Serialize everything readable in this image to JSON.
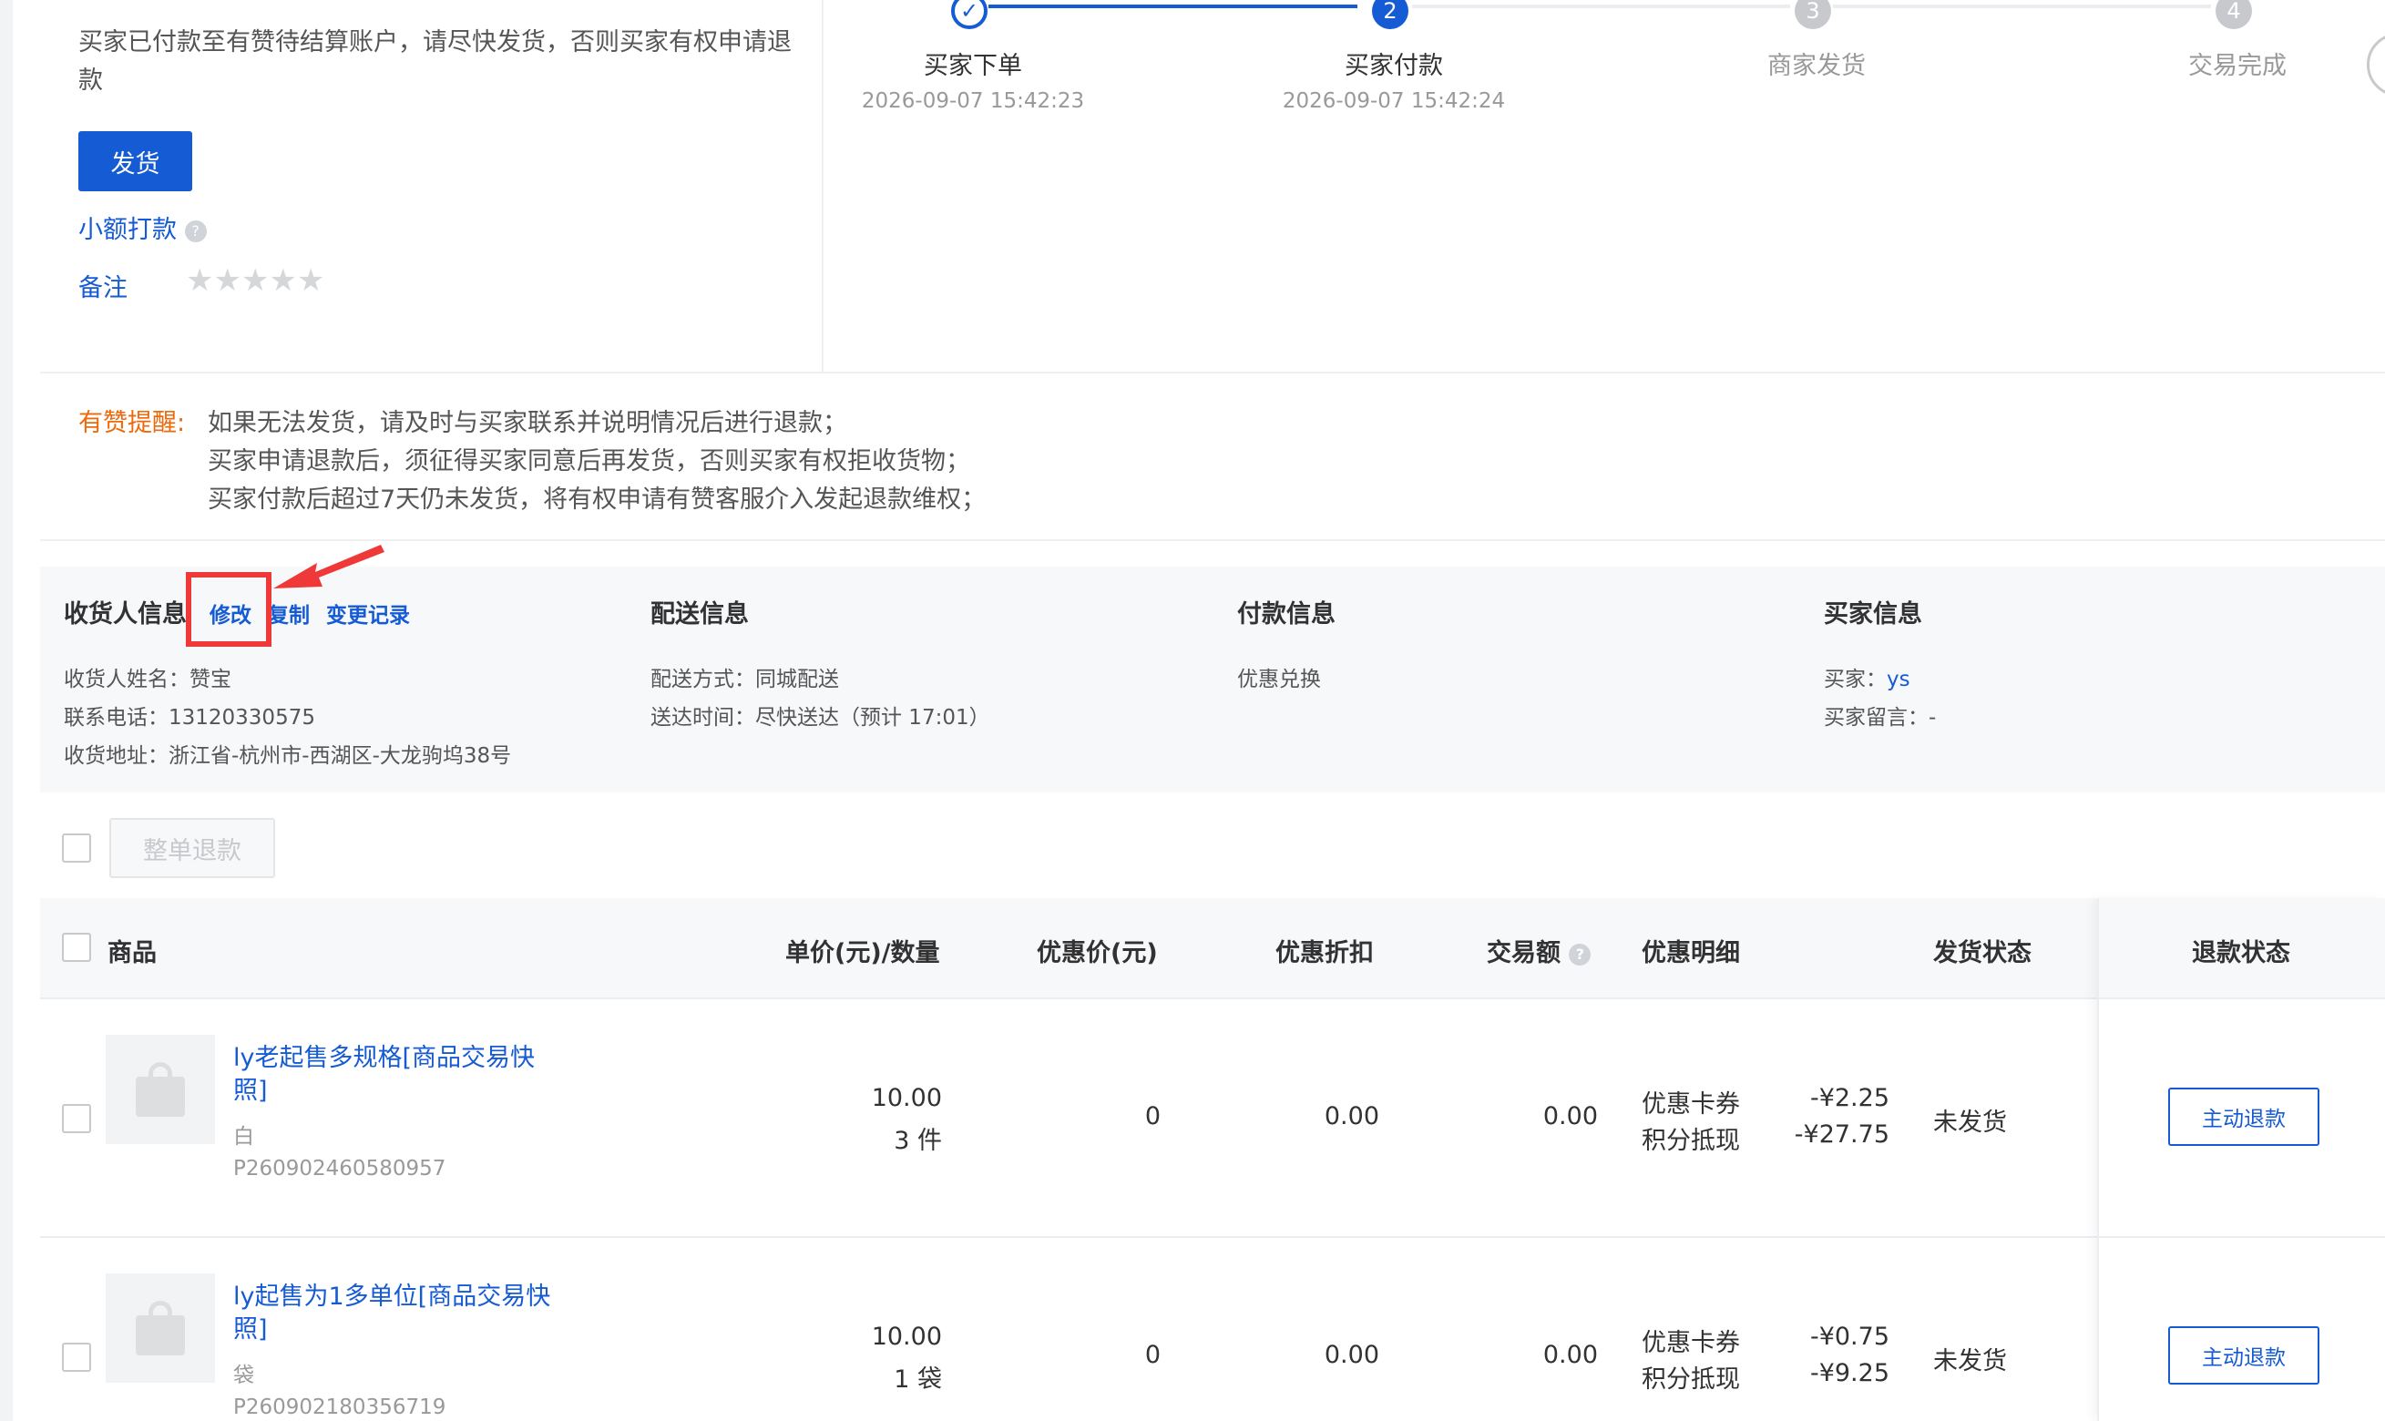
{
  "status": {
    "description": "买家已付款至有赞待结算账户，请尽快发货，否则买家有权申请退款",
    "ship_button": "发货",
    "small_payment_link": "小额打款",
    "remark_label": "备注",
    "remark_stars": 0,
    "remark_stars_max": 5
  },
  "steps": [
    {
      "label": "买家下单",
      "time": "2026-09-07 15:42:23",
      "marker": "✓",
      "state": "done"
    },
    {
      "label": "买家付款",
      "time": "2026-09-07 15:42:24",
      "marker": "2",
      "state": "active"
    },
    {
      "label": "商家发货",
      "time": "",
      "marker": "3",
      "state": "pending"
    },
    {
      "label": "交易完成",
      "time": "",
      "marker": "4",
      "state": "pending"
    }
  ],
  "reminder": {
    "title": "有赞提醒:",
    "lines": [
      "如果无法发货，请及时与买家联系并说明情况后进行退款；",
      "买家申请退款后，须征得买家同意后再发货，否则买家有权拒收货物；",
      "买家付款后超过7天仍未发货，将有权申请有赞客服介入发起退款维权；"
    ]
  },
  "receiver": {
    "title": "收货人信息",
    "edit": "修改",
    "copy": "复制",
    "history": "变更记录",
    "name": "收货人姓名：赞宝",
    "phone": "联系电话：13120330575",
    "address": "收货地址：浙江省-杭州市-西湖区-大龙驹坞38号"
  },
  "delivery": {
    "title": "配送信息",
    "method": "配送方式：同城配送",
    "time": "送达时间：尽快送达（预计 17:01）"
  },
  "payment": {
    "title": "付款信息",
    "method": "优惠兑换"
  },
  "buyer": {
    "title": "买家信息",
    "label": "买家：",
    "name": "ys",
    "message": "买家留言：-"
  },
  "table": {
    "bulk_refund": "整单退款",
    "headers": {
      "product": "商品",
      "price_qty": "单价(元)/数量",
      "discount_price": "优惠价(元)",
      "discount": "优惠折扣",
      "amount": "交易额",
      "discount_detail": "优惠明细",
      "ship_status": "发货状态",
      "refund_status": "退款状态"
    },
    "rows": [
      {
        "name": "ly老起售多规格[商品交易快照]",
        "sku": "白",
        "code": "P260902460580957",
        "price": "10.00",
        "qty": "3 件",
        "discount_price": "0",
        "discount": "0.00",
        "amount": "0.00",
        "promo1_label": "优惠卡券",
        "promo1_value": "-¥2.25",
        "promo2_label": "积分抵现",
        "promo2_value": "-¥27.75",
        "ship_status": "未发货",
        "refund_button": "主动退款"
      },
      {
        "name": "ly起售为1多单位[商品交易快照]",
        "sku": "袋",
        "code": "P260902180356719",
        "price": "10.00",
        "qty": "1 袋",
        "discount_price": "0",
        "discount": "0.00",
        "amount": "0.00",
        "promo1_label": "优惠卡券",
        "promo1_value": "-¥0.75",
        "promo2_label": "积分抵现",
        "promo2_value": "-¥9.25",
        "ship_status": "未发货",
        "refund_button": "主动退款"
      }
    ]
  },
  "colors": {
    "primary": "#155bd4",
    "warning": "#ed6a0c",
    "annotation_red": "#ef3838"
  }
}
